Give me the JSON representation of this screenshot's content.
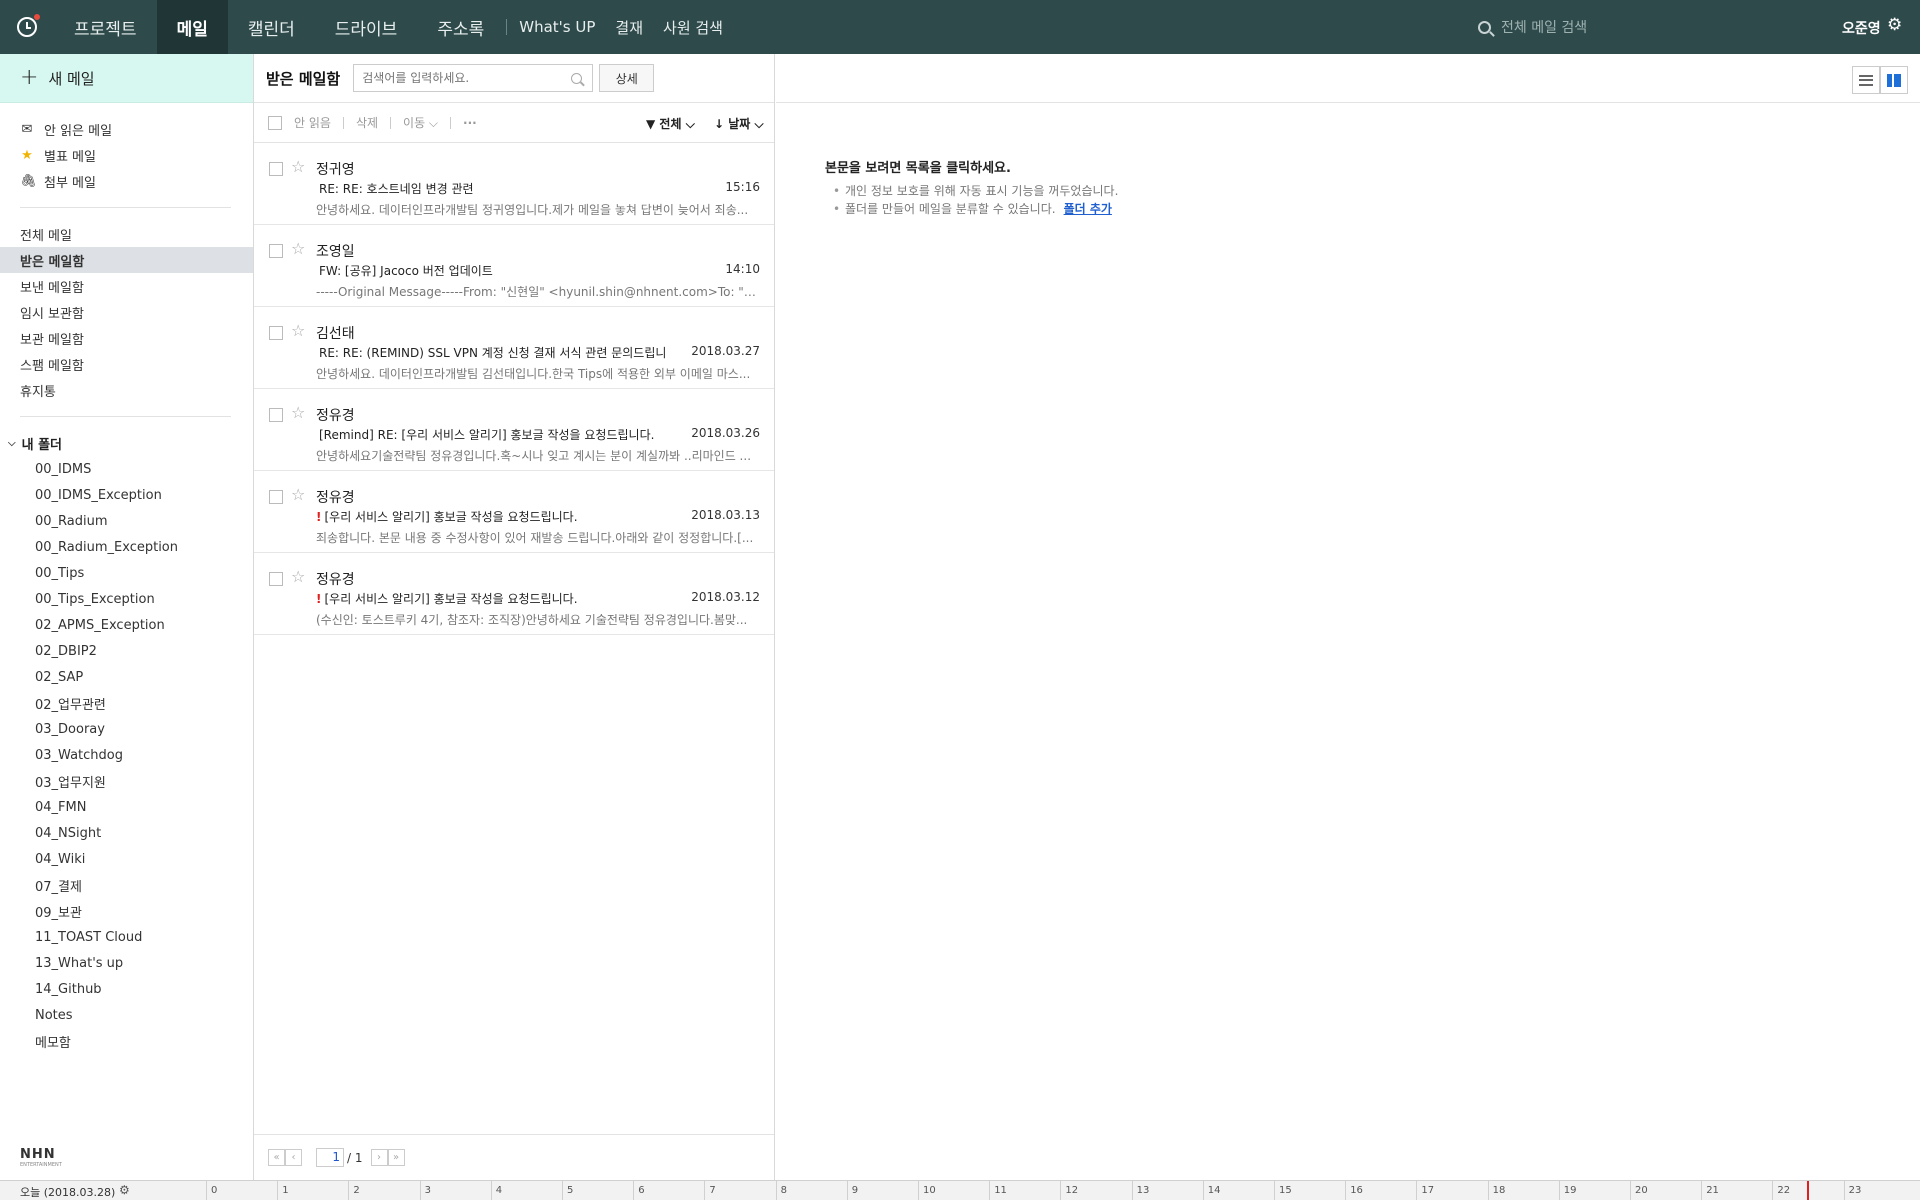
{
  "topnav": {
    "main_items": [
      "프로젝트",
      "메일",
      "캘린더",
      "드라이브",
      "주소록"
    ],
    "active_item": "메일",
    "extra_items": [
      "What's UP",
      "결재",
      "사원 검색"
    ],
    "search_placeholder": "전체 메일 검색",
    "user_name": "오준영",
    "settings_icon": "gear-icon"
  },
  "sidebar": {
    "new_mail_label": "새 메일",
    "quick_items": [
      {
        "label": "안 읽은 메일",
        "icon": "envelope-icon"
      },
      {
        "label": "별표 메일",
        "icon": "star-icon"
      },
      {
        "label": "첨부 메일",
        "icon": "paperclip-icon"
      }
    ],
    "mailboxes": [
      "전체 메일",
      "받은 메일함",
      "보낸 메일함",
      "임시 보관함",
      "보관 메일함",
      "스팸 메일함",
      "휴지통"
    ],
    "selected_mailbox": "받은 메일함",
    "my_folders_label": "내 폴더",
    "folders": [
      "00_IDMS",
      "00_IDMS_Exception",
      "00_Radium",
      "00_Radium_Exception",
      "00_Tips",
      "00_Tips_Exception",
      "02_APMS_Exception",
      "02_DBIP2",
      "02_SAP",
      "02_업무관련",
      "03_Dooray",
      "03_Watchdog",
      "03_업무지원",
      "04_FMN",
      "04_NSight",
      "04_Wiki",
      "07_결제",
      "09_보관",
      "11_TOAST Cloud",
      "13_What's up",
      "14_Github",
      "Notes",
      "메모함"
    ],
    "brand": "NHN",
    "brand_sub": "ENTERTAINMENT"
  },
  "list": {
    "title": "받은 메일함",
    "search_placeholder": "검색어를 입력하세요.",
    "detail_button": "상세",
    "toolbar": {
      "unread": "안 읽음",
      "delete": "삭제",
      "move": "이동 ⌵",
      "more": "···",
      "filter": "전체",
      "sort": "날짜"
    },
    "mails": [
      {
        "sender": "정귀영",
        "important": "",
        "subject": "RE: RE: 호스트네임 변경 관련",
        "date": "15:16",
        "preview": "안녕하세요. 데이터인프라개발팀 정귀영입니다.제가 메일을 놓쳐 답변이 늦어서 죄송..."
      },
      {
        "sender": "조영일",
        "important": "",
        "subject": "FW: [공유] Jacoco 버전 업데이트",
        "date": "14:10",
        "preview": "-----Original Message-----From: \"신현일\" <hyunil.shin@nhnent.com>To: \"메세징..."
      },
      {
        "sender": "김선태",
        "important": "",
        "subject": "RE: RE: (REMIND) SSL VPN 계정 신청 결재 서식 관련 문의드립니다.",
        "date": "2018.03.27",
        "preview": "안녕하세요. 데이터인프라개발팀 김선태입니다.한국 Tips에 적용한 외부 이메일 마스..."
      },
      {
        "sender": "정유경",
        "important": "",
        "subject": "[Remind] RE: [우리 서비스 알리기] 홍보글 작성을 요청드립니다.",
        "date": "2018.03.26",
        "preview": "안녕하세요기술전략팀 정유경입니다.혹~시나 잊고 계시는 분이 계실까봐 ..리마인드 ..."
      },
      {
        "sender": "정유경",
        "important": "!",
        "subject": "[우리 서비스 알리기] 홍보글 작성을 요청드립니다.",
        "date": "2018.03.13",
        "preview": "죄송합니다. 본문 내용 중 수정사항이 있어 재발송 드립니다.아래와 같이 정정합니다.[..."
      },
      {
        "sender": "정유경",
        "important": "!",
        "subject": "[우리 서비스 알리기] 홍보글 작성을 요청드립니다.",
        "date": "2018.03.12",
        "preview": "(수신인: 토스트루키 4기, 참조자: 조직장)안녕하세요 기술전략팀 정유경입니다.봄맞..."
      }
    ],
    "pager": {
      "current": "1",
      "total": "/ 1"
    }
  },
  "reading": {
    "heading": "본문을 보려면 목록을 클릭하세요.",
    "tips": [
      "개인 정보 보호를 위해 자동 표시 기능을 꺼두었습니다.",
      "폴더를 만들어 메일을 분류할 수 있습니다."
    ],
    "add_folder_link": "폴더 추가"
  },
  "timeline": {
    "today_label": "오늘 (2018.03.28)",
    "hours": [
      "0",
      "1",
      "2",
      "3",
      "4",
      "5",
      "6",
      "7",
      "8",
      "9",
      "10",
      "11",
      "12",
      "13",
      "14",
      "15",
      "16",
      "17",
      "18",
      "19",
      "20",
      "21",
      "22",
      "23"
    ]
  }
}
